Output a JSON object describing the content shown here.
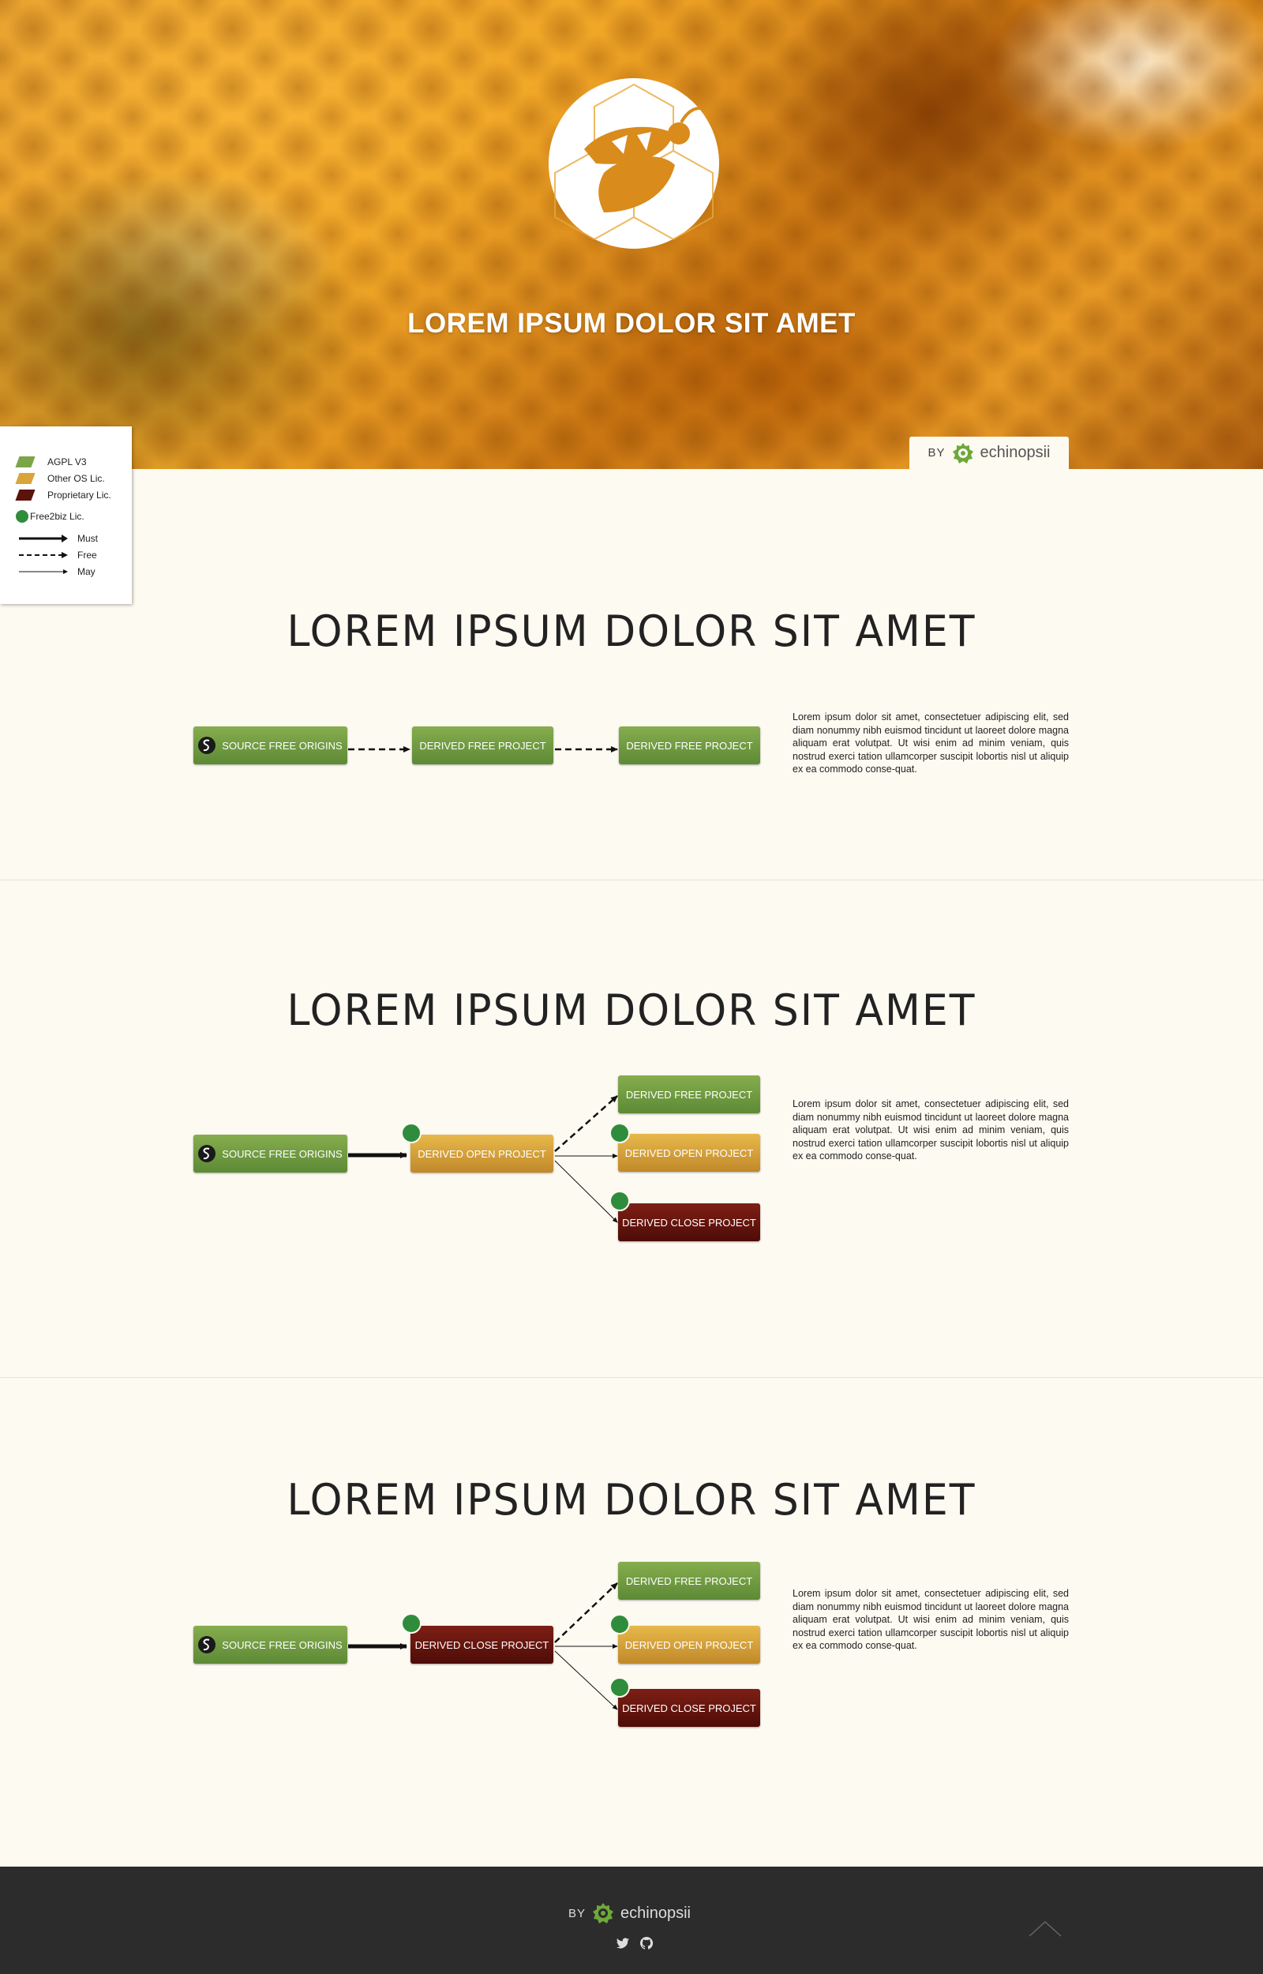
{
  "hero": {
    "title": "LOREM IPSUM DOLOR SIT AMET",
    "by": "BY",
    "brand": "echinopsii"
  },
  "legend": {
    "licenses": [
      {
        "label": "AGPL V3",
        "color": "#7aa548"
      },
      {
        "label": "Other OS Lic.",
        "color": "#d9a43a"
      },
      {
        "label": "Proprietary Lic.",
        "color": "#5c130c"
      }
    ],
    "free2biz": "Free2biz Lic.",
    "arrows": [
      {
        "label": "Must",
        "style": "solid-thick"
      },
      {
        "label": "Free",
        "style": "dashed"
      },
      {
        "label": "May",
        "style": "thin"
      }
    ]
  },
  "sections": [
    {
      "title": "LOREM IPSUM DOLOR SIT AMET",
      "source": "SOURCE FREE ORIGINS",
      "middle": "DERIVED FREE PROJECT",
      "right": [
        "DERIVED FREE PROJECT"
      ],
      "text": "Lorem ipsum dolor sit amet, consectetuer adipiscing elit, sed diam nonummy nibh euismod tincidunt ut laoreet dolore magna aliquam erat volutpat. Ut wisi enim ad minim veniam, quis nostrud exerci tation ullamcorper suscipit lobortis nisl ut aliquip ex ea commodo conse-quat."
    },
    {
      "title": "LOREM IPSUM DOLOR SIT AMET",
      "source": "SOURCE FREE ORIGINS",
      "middle": "DERIVED OPEN PROJECT",
      "right": [
        "DERIVED FREE PROJECT",
        "DERIVED OPEN PROJECT",
        "DERIVED CLOSE PROJECT"
      ],
      "text": "Lorem ipsum dolor sit amet, consectetuer adipiscing elit, sed diam nonummy nibh euismod tincidunt ut laoreet dolore magna aliquam erat volutpat. Ut wisi enim ad minim veniam, quis nostrud exerci tation ullamcorper suscipit lobortis nisl ut aliquip ex ea commodo conse-quat."
    },
    {
      "title": "LOREM IPSUM DOLOR SIT AMET",
      "source": "SOURCE FREE ORIGINS",
      "middle": "DERIVED CLOSE PROJECT",
      "right": [
        "DERIVED FREE PROJECT",
        "DERIVED OPEN PROJECT",
        "DERIVED CLOSE PROJECT"
      ],
      "text": "Lorem ipsum dolor sit amet, consectetuer adipiscing elit, sed diam nonummy nibh euismod tincidunt ut laoreet dolore magna aliquam erat volutpat. Ut wisi enim ad minim veniam, quis nostrud exerci tation ullamcorper suscipit lobortis nisl ut aliquip ex ea commodo conse-quat."
    }
  ],
  "footer": {
    "by": "BY",
    "brand": "echinopsii",
    "social_icons": [
      "twitter-icon",
      "github-icon"
    ],
    "scroll_top_icon": "chevron-up-icon"
  }
}
